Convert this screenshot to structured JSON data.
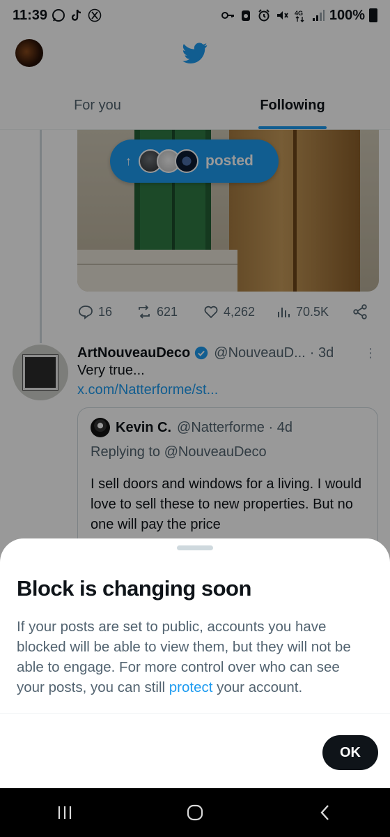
{
  "status_bar": {
    "time": "11:39",
    "battery": "100%",
    "left_icons": [
      "whatsapp-icon",
      "tiktok-icon",
      "x-icon"
    ],
    "right_icons": [
      "vpn-key-icon",
      "app-icon",
      "alarm-icon",
      "mute-icon",
      "4g-icon",
      "signal-icon",
      "battery-icon"
    ]
  },
  "header": {
    "logo": "twitter-bird-icon"
  },
  "tabs": [
    {
      "label": "For you",
      "active": false
    },
    {
      "label": "Following",
      "active": true
    }
  ],
  "feed": {
    "posted_pill": {
      "label": "posted"
    },
    "post1_actions": {
      "replies": "16",
      "reposts": "621",
      "likes": "4,262",
      "views": "70.5K"
    },
    "post2": {
      "name": "ArtNouveauDeco",
      "handle": "@NouveauD...",
      "time": "· 3d",
      "text": "Very true...",
      "link": "x.com/Natterforme/st...",
      "quote": {
        "name": "Kevin C.",
        "handle": "@Natterforme · 4d",
        "reply_to": "Replying to @NouveauDeco",
        "body": "I sell doors and windows for a living. I would love to sell these to new properties. But no one will pay the price"
      }
    }
  },
  "sheet": {
    "title": "Block is changing soon",
    "body_before": "If your posts are set to public, accounts you have blocked will be able to view them, but they will not be able to engage. For more control over who can see your posts, you can still ",
    "body_link": "protect",
    "body_after": " your account.",
    "ok_label": "OK"
  },
  "colors": {
    "accent": "#1d9bf0",
    "text": "#0f1419",
    "secondary": "#536471"
  }
}
